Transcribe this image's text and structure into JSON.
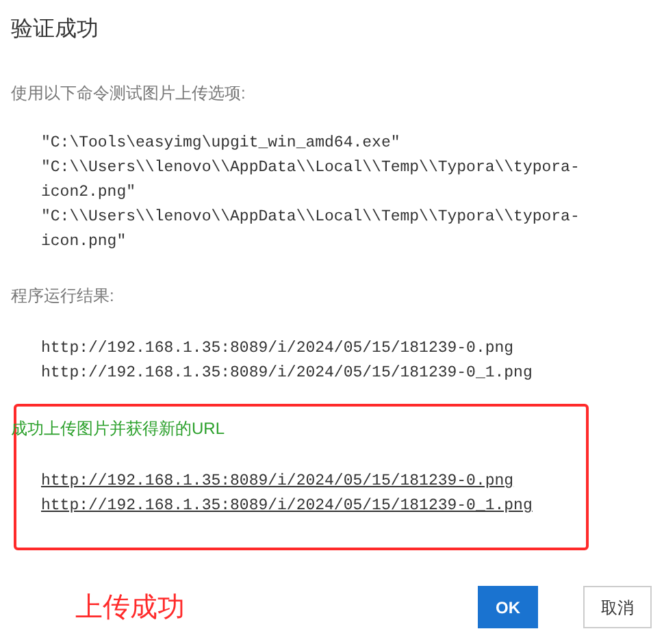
{
  "dialog": {
    "title": "验证成功",
    "test_label": "使用以下命令测试图片上传选项:",
    "commands": [
      "\"C:\\Tools\\easyimg\\upgit_win_amd64.exe\"",
      "\"C:\\\\Users\\\\lenovo\\\\AppData\\\\Local\\\\Temp\\\\Typora\\\\typora-icon2.png\"",
      "\"C:\\\\Users\\\\lenovo\\\\AppData\\\\Local\\\\Temp\\\\Typora\\\\typora-icon.png\""
    ],
    "result_label": "程序运行结果:",
    "results": [
      "http://192.168.1.35:8089/i/2024/05/15/181239-0.png",
      "http://192.168.1.35:8089/i/2024/05/15/181239-0_1.png"
    ],
    "success_message": "成功上传图片并获得新的URL",
    "urls": [
      "http://192.168.1.35:8089/i/2024/05/15/181239-0.png",
      "http://192.168.1.35:8089/i/2024/05/15/181239-0_1.png"
    ],
    "annotation": "上传成功",
    "buttons": [
      {
        "label": "OK",
        "kind": "primary"
      },
      {
        "label": "取消",
        "kind": "secondary"
      }
    ]
  }
}
